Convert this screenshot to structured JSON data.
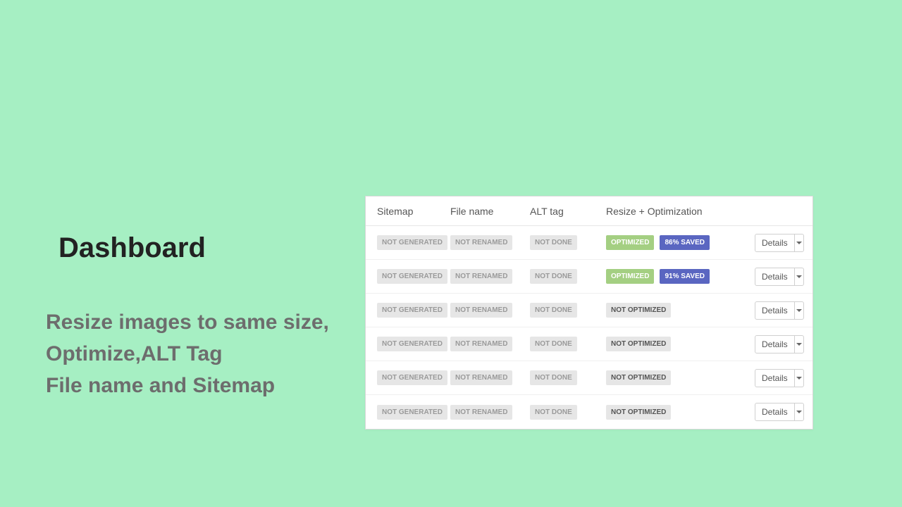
{
  "left": {
    "heading": "Dashboard",
    "line1": "Resize images to same size,",
    "line2": "Optimize,ALT Tag",
    "line3": "File name and Sitemap"
  },
  "headers": {
    "sitemap": "Sitemap",
    "filename": "File name",
    "alt": "ALT tag",
    "resize": "Resize + Optimization"
  },
  "statuses": {
    "not_generated": "NOT GENERATED",
    "not_renamed": "NOT RENAMED",
    "not_done": "NOT DONE",
    "optimized": "OPTIMIZED",
    "not_optimized": "NOT OPTIMIZED"
  },
  "details_label": "Details",
  "rows": [
    {
      "optimized": true,
      "saved": "86% SAVED"
    },
    {
      "optimized": true,
      "saved": "91% SAVED"
    },
    {
      "optimized": false
    },
    {
      "optimized": false
    },
    {
      "optimized": false
    },
    {
      "optimized": false
    }
  ]
}
